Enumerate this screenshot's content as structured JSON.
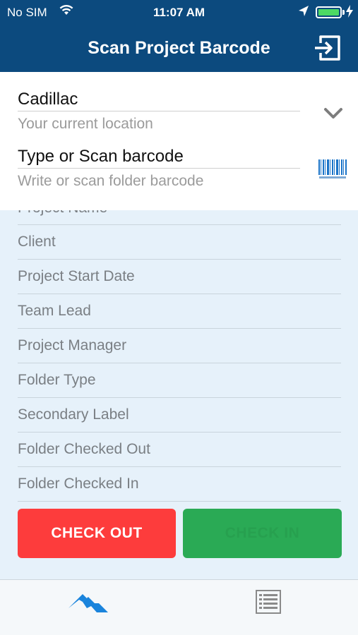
{
  "status_bar": {
    "carrier": "No SIM",
    "time": "11:07 AM"
  },
  "nav": {
    "title": "Scan Project Barcode"
  },
  "location": {
    "value": "Cadillac",
    "hint": "Your current location"
  },
  "barcode": {
    "value": "Type or Scan barcode",
    "hint": "Write or scan folder barcode"
  },
  "details": {
    "rows": [
      "Project Name",
      "Client",
      "Project Start Date",
      "Team Lead",
      "Project Manager",
      "Folder Type",
      "Secondary Label",
      "Folder Checked Out",
      "Folder Checked In"
    ]
  },
  "actions": {
    "check_out": "CHECK OUT",
    "check_in": "CHECK IN"
  },
  "colors": {
    "header": "#0c4a7e",
    "check_out": "#fd3c3c",
    "check_in": "#2aaa55",
    "background": "#e6f1fa",
    "accent": "#1a84dc"
  },
  "icons": {
    "exit": "sign-out-icon",
    "dropdown": "chevron-down-icon",
    "barcode": "barcode-icon",
    "home_tab": "mountain-icon",
    "list_tab": "list-icon"
  }
}
